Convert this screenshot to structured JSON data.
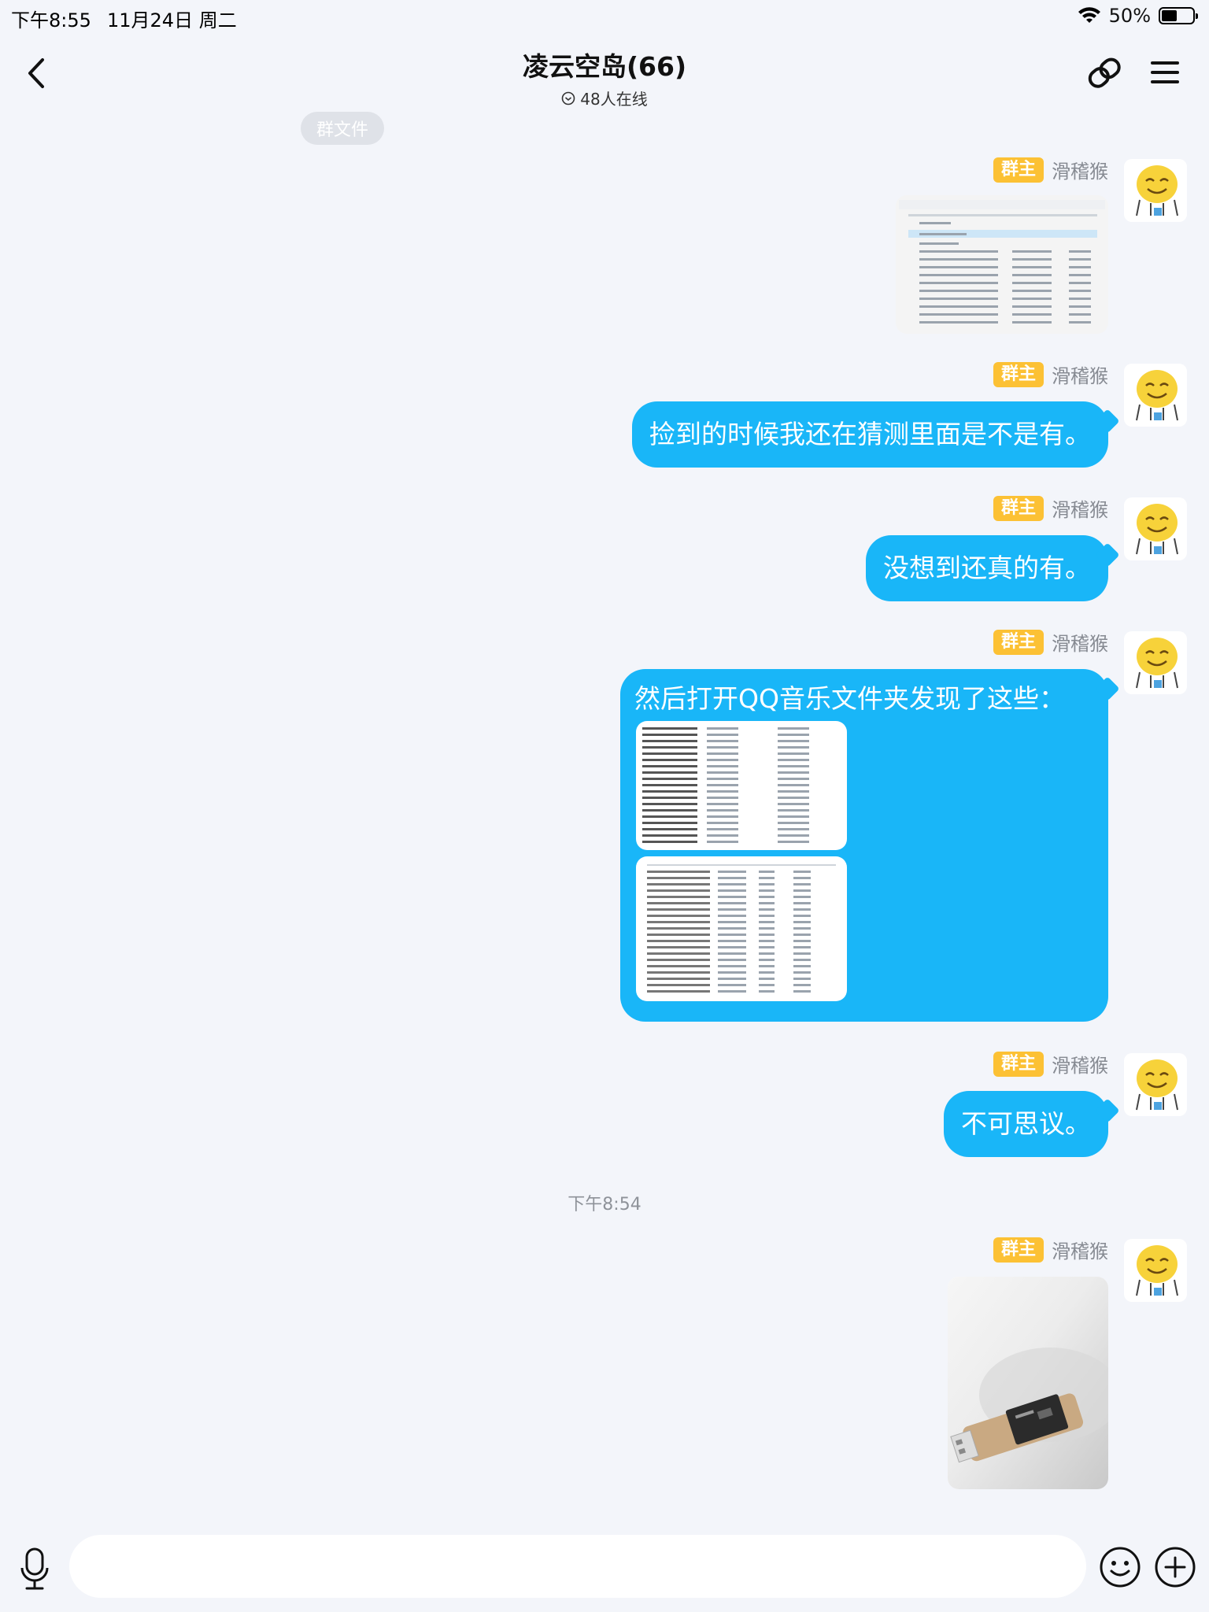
{
  "status_bar": {
    "time": "下午8:55",
    "date": "11月24日 周二",
    "battery": "50%",
    "battery_level": 0.5
  },
  "header": {
    "title": "凌云空岛(66)",
    "online": "48人在线"
  },
  "chip": {
    "group_file": "群文件"
  },
  "messages": [
    {
      "type": "image",
      "badge": "群主",
      "sender": "滑稽猴",
      "description": "file-explorer-screenshot"
    },
    {
      "type": "text",
      "badge": "群主",
      "sender": "滑稽猴",
      "text": "捡到的时候我还在猜测里面是不是有。"
    },
    {
      "type": "text",
      "badge": "群主",
      "sender": "滑稽猴",
      "text": "没想到还真的有。"
    },
    {
      "type": "text_images",
      "badge": "群主",
      "sender": "滑稽猴",
      "text": "然后打开QQ音乐文件夹发现了这些："
    },
    {
      "type": "text",
      "badge": "群主",
      "sender": "滑稽猴",
      "text": "不可思议。"
    },
    {
      "type": "image",
      "badge": "群主",
      "sender": "滑稽猴",
      "description": "usb-card-reader-photo"
    }
  ],
  "timestamp": "下午8:54",
  "input": {
    "placeholder": ""
  },
  "colors": {
    "bubble": "#19b6f8",
    "badge": "#fcc134",
    "background": "#f3f5fa"
  }
}
